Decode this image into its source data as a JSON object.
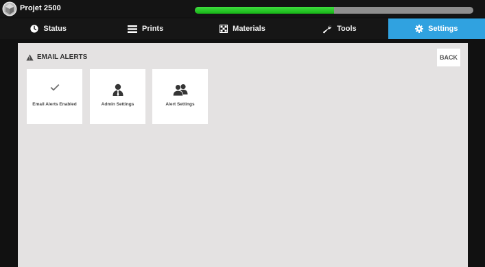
{
  "app": {
    "title": "Projet 2500",
    "progress_fraction": 0.5
  },
  "tabs": [
    {
      "label": "Status",
      "icon": "clock-icon",
      "active": false
    },
    {
      "label": "Prints",
      "icon": "list-icon",
      "active": false
    },
    {
      "label": "Materials",
      "icon": "checkered-box-icon",
      "active": false
    },
    {
      "label": "Tools",
      "icon": "wrench-icon",
      "active": false
    },
    {
      "label": "Settings",
      "icon": "gear-icon",
      "active": true
    }
  ],
  "page": {
    "title": "EMAIL ALERTS",
    "back_label": "BACK"
  },
  "tiles": [
    {
      "label": "Email Alerts Enabled",
      "icon": "checkmark-icon"
    },
    {
      "label": "Admin Settings",
      "icon": "person-icon"
    },
    {
      "label": "Alert Settings",
      "icon": "people-icon"
    }
  ],
  "colors": {
    "accent": "#30a2e0",
    "progress": "#22c322",
    "content_bg": "#e4e2e2"
  }
}
